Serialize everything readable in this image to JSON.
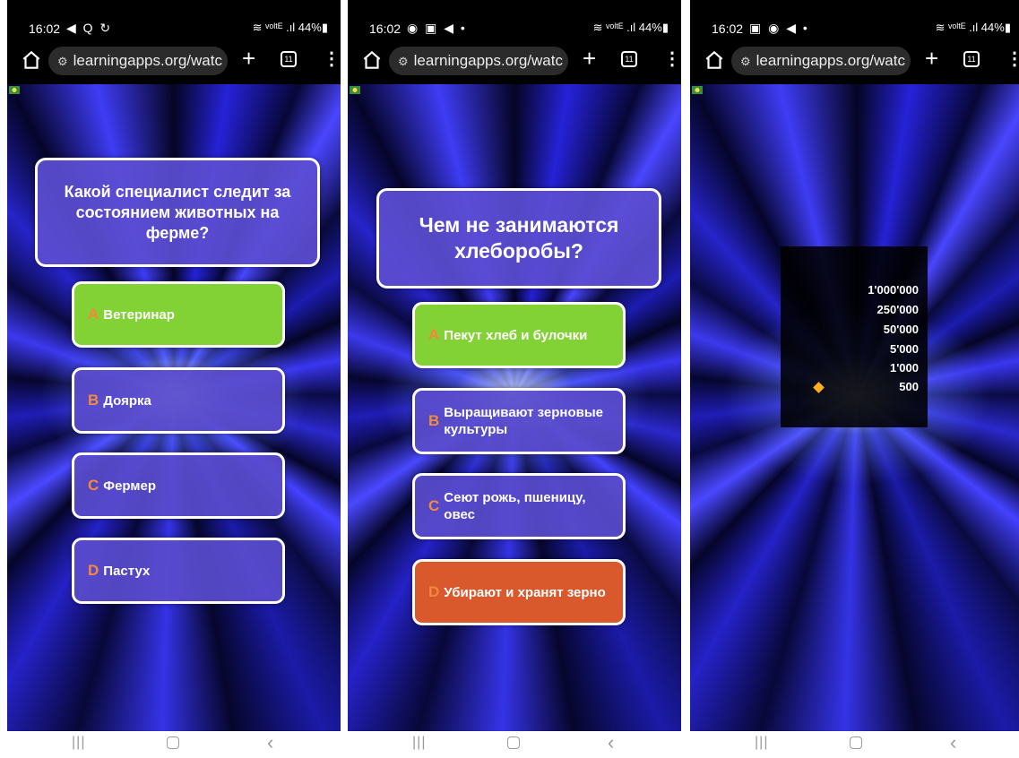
{
  "phones": [
    {
      "status": {
        "time": "16:02",
        "icons": "◀ Q ↻",
        "right": "≋ ᵛᵒˡᵗᴱ .ıl 44%▮"
      },
      "browser": {
        "url": "learningapps.org/watc",
        "tabs_count": "11",
        "plus": "+",
        "menu": "⋮"
      },
      "question": "Какой специалист следит за состоянием животных на ферме?",
      "answers": [
        {
          "letter": "A",
          "text": "Ветеринар",
          "state": "correct"
        },
        {
          "letter": "B",
          "text": "Доярка",
          "state": "normal"
        },
        {
          "letter": "C",
          "text": "Фермер",
          "state": "normal"
        },
        {
          "letter": "D",
          "text": "Пастух",
          "state": "normal"
        }
      ]
    },
    {
      "status": {
        "time": "16:02",
        "icons": "◉ ▣ ◀ •",
        "right": "≋ ᵛᵒˡᵗᴱ .ıl 44%▮"
      },
      "browser": {
        "url": "learningapps.org/watc",
        "tabs_count": "11",
        "plus": "+",
        "menu": "⋮"
      },
      "question": "Чем не занимаются хлеборобы?",
      "answers": [
        {
          "letter": "A",
          "text": "Пекут хлеб и булочки",
          "state": "correct"
        },
        {
          "letter": "B",
          "text": "Выращивают зерновые культуры",
          "state": "normal"
        },
        {
          "letter": "C",
          "text": "Сеют рожь, пшеницу, овес",
          "state": "normal"
        },
        {
          "letter": "D",
          "text": "Убирают и хранят зерно",
          "state": "wrong"
        }
      ]
    },
    {
      "status": {
        "time": "16:02",
        "icons": "▣ ◉ ◀ •",
        "right": "≋ ᵛᵒˡᵗᴱ .ıl 44%▮"
      },
      "browser": {
        "url": "learningapps.org/watc",
        "tabs_count": "11",
        "plus": "+",
        "menu": "⋮"
      },
      "prize_ladder": [
        "1'000'000",
        "250'000",
        "50'000",
        "5'000",
        "1'000",
        "500"
      ],
      "current_prize": "500"
    }
  ],
  "nav": {
    "recent": "|||",
    "back": "‹"
  },
  "colors": {
    "correct": "#82d235",
    "wrong": "#d9582c",
    "answer": "#5a4ccd",
    "letter": "#f28a3a",
    "marker": "#ffb11c"
  },
  "icons": [
    "home-icon",
    "tune-icon",
    "plus-icon",
    "tabs-icon",
    "menu-icon",
    "flag-icon",
    "recent-apps-icon",
    "home-nav-icon",
    "back-icon"
  ]
}
